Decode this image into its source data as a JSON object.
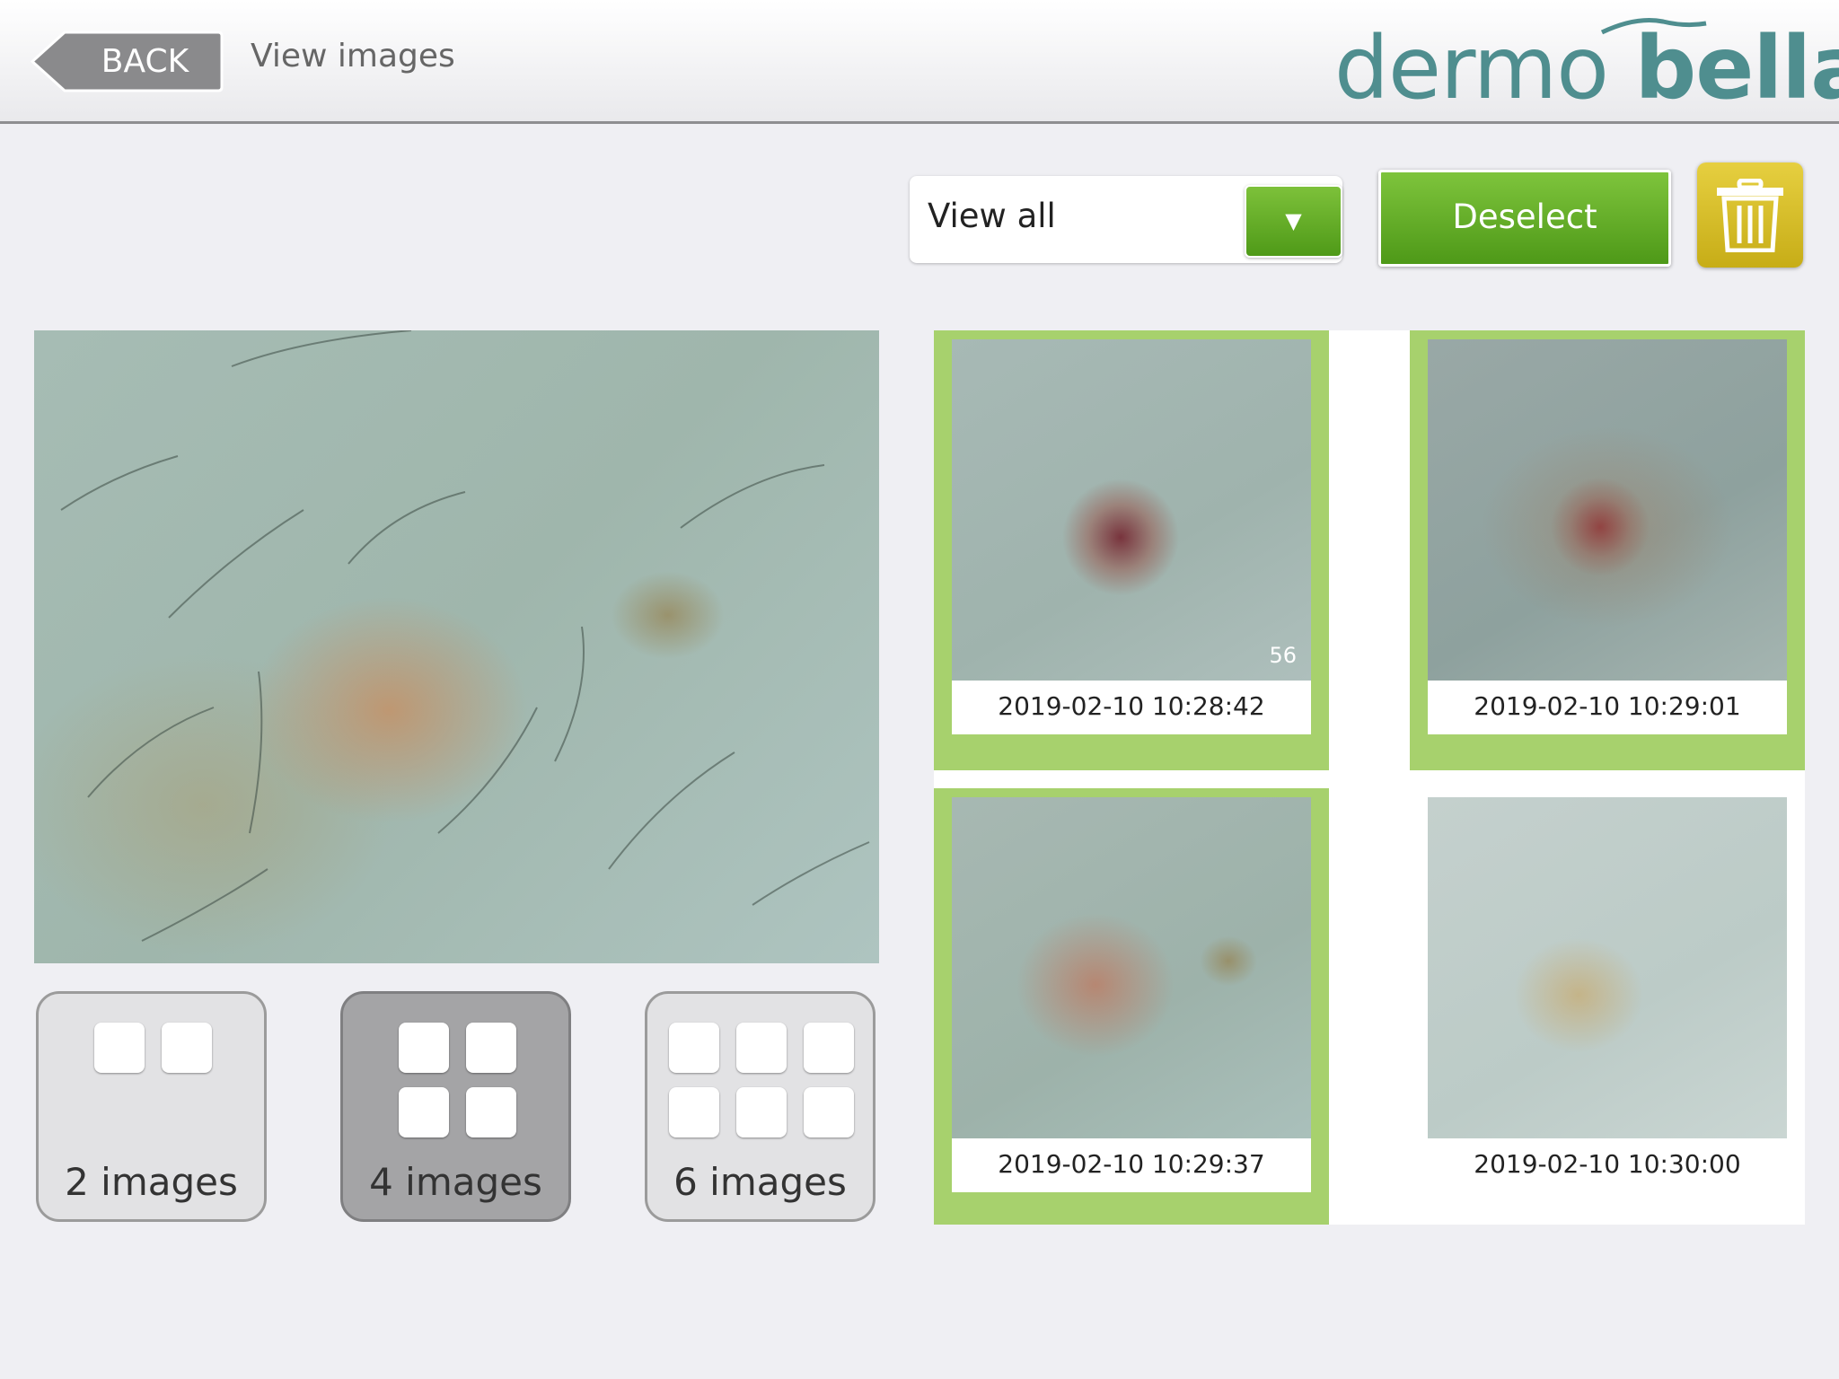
{
  "header": {
    "back_label": "BACK",
    "title": "View images",
    "logo": {
      "part1": "dermo",
      "part2": "bella",
      "color": "#4f8e8f"
    }
  },
  "toolbar": {
    "filter": {
      "selected": "View all",
      "icon": "chevron-down-icon"
    },
    "deselect_label": "Deselect",
    "delete_icon": "trash-icon",
    "accent_green": "#5fab22",
    "delete_color": "#d8be2a"
  },
  "layouts": [
    {
      "label": "2 images",
      "active": false
    },
    {
      "label": "4 images",
      "active": true
    },
    {
      "label": "6 images",
      "active": false
    }
  ],
  "thumbnails": [
    {
      "timestamp": "2019-02-10 10:28:42",
      "selected": true,
      "count": "56"
    },
    {
      "timestamp": "2019-02-10 10:29:01",
      "selected": true,
      "count": ""
    },
    {
      "timestamp": "2019-02-10 10:29:37",
      "selected": true,
      "count": ""
    },
    {
      "timestamp": "2019-02-10 10:30:00",
      "selected": false,
      "count": ""
    }
  ],
  "selection_color": "#a7d16d"
}
